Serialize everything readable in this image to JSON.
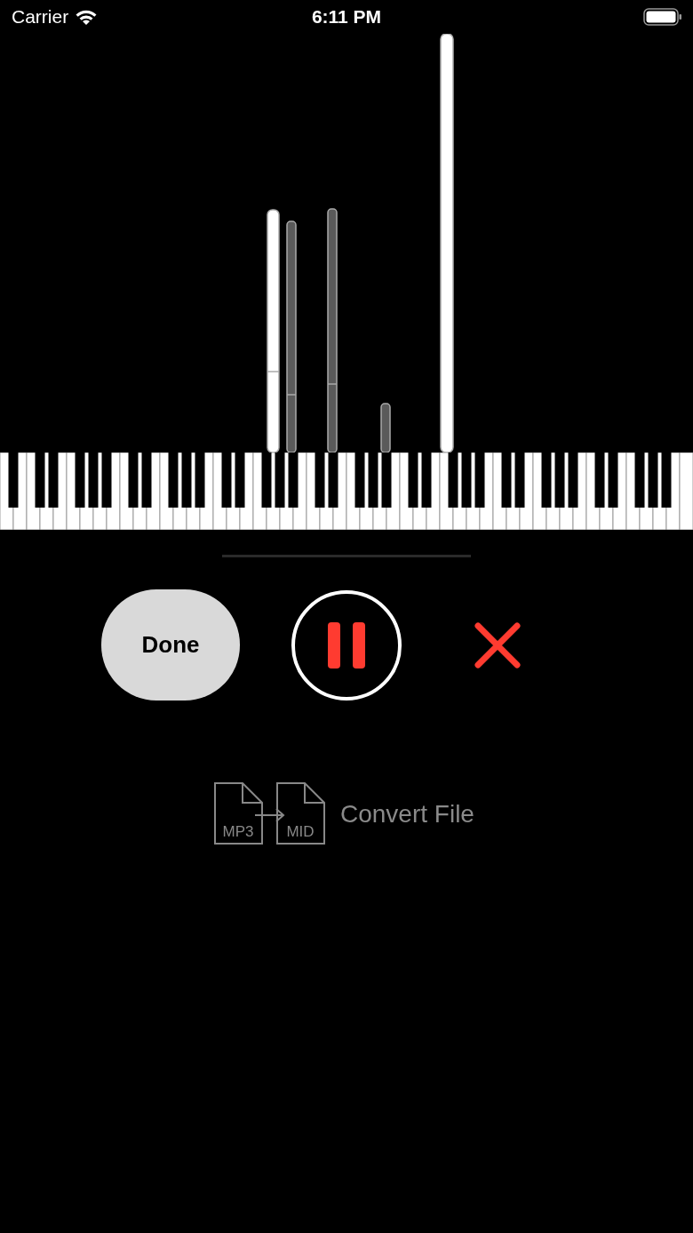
{
  "status_bar": {
    "carrier": "Carrier",
    "time": "6:11 PM"
  },
  "controls": {
    "done_button": {
      "label": "Done"
    },
    "playback": {
      "playing": true
    }
  },
  "convert": {
    "label": "Convert File",
    "from_format": "MP3",
    "to_format": "MID"
  }
}
